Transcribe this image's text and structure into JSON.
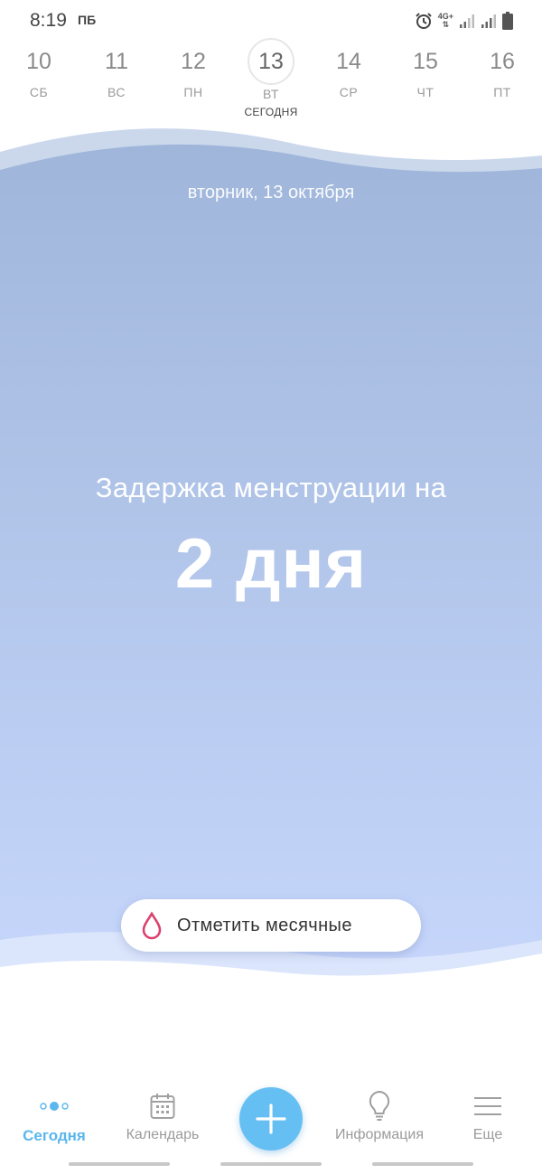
{
  "status_bar": {
    "time": "8:19",
    "carrier": "ПБ",
    "network": "4G+"
  },
  "week": [
    {
      "num": "10",
      "weekday": "СБ"
    },
    {
      "num": "11",
      "weekday": "ВС"
    },
    {
      "num": "12",
      "weekday": "ПН"
    },
    {
      "num": "13",
      "weekday": "ВТ",
      "today_label": "СЕГОДНЯ"
    },
    {
      "num": "14",
      "weekday": "СР"
    },
    {
      "num": "15",
      "weekday": "ЧТ"
    },
    {
      "num": "16",
      "weekday": "ПТ"
    }
  ],
  "main": {
    "date": "вторник, 13 октября",
    "delay_text": "Задержка менструации на",
    "delay_days": "2 дня",
    "mark_button": "Отметить месячные"
  },
  "nav": {
    "today": "Сегодня",
    "calendar": "Календарь",
    "info": "Информация",
    "more": "Еще"
  },
  "colors": {
    "accent": "#66bff3",
    "active_nav": "#5ab6ee",
    "gradient_top": "#9fb6da",
    "gradient_bottom": "#c6d6fb",
    "drop_icon": "#d9436e"
  },
  "icons": {
    "today": "dots-icon",
    "calendar": "calendar-icon",
    "info": "lightbulb-icon",
    "more": "menu-icon",
    "fab": "plus-icon",
    "mark": "drop-icon"
  }
}
